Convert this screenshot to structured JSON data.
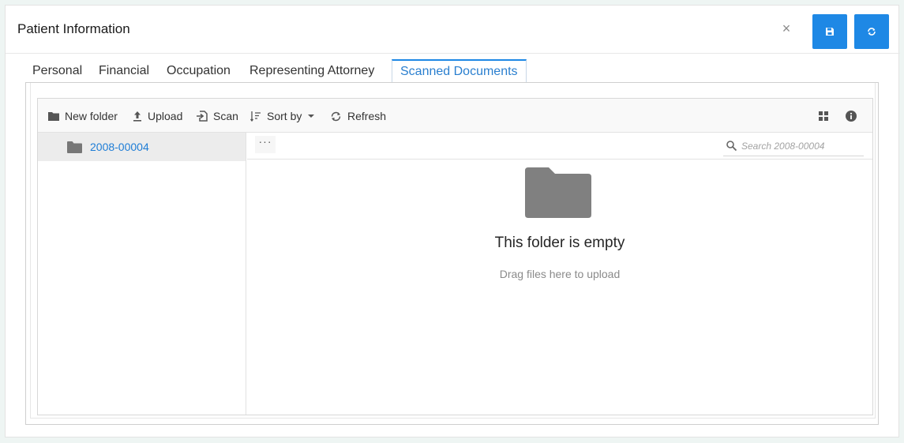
{
  "dialog": {
    "title": "Patient Information",
    "close_glyph": "×",
    "buttons": [
      {
        "name": "save",
        "icon": "floppy-disk-icon"
      },
      {
        "name": "sync",
        "icon": "sync-icon"
      }
    ],
    "accent_color": "#1e88e5"
  },
  "tabs": [
    {
      "label": "Personal",
      "active": false
    },
    {
      "label": "Financial",
      "active": false
    },
    {
      "label": "Occupation",
      "active": false
    },
    {
      "label": "Representing Attorney",
      "active": false
    },
    {
      "label": "Scanned Documents",
      "active": true
    }
  ],
  "file_manager": {
    "toolbar": {
      "new_folder": "New folder",
      "upload": "Upload",
      "scan": "Scan",
      "sort_by": "Sort by",
      "refresh": "Refresh"
    },
    "nav": {
      "items": [
        {
          "label": "2008-00004",
          "icon": "folder-icon",
          "selected": true
        }
      ]
    },
    "breadcrumb": {
      "more": "···"
    },
    "search": {
      "placeholder": "Search 2008-00004",
      "value": ""
    },
    "empty": {
      "title": "This folder is empty",
      "subtitle": "Drag files here to upload"
    }
  }
}
